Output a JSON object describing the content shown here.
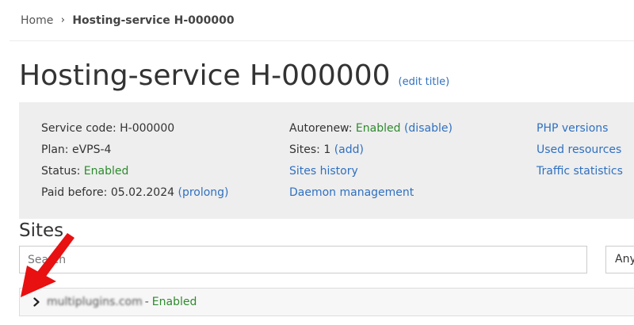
{
  "breadcrumb": {
    "home": "Home",
    "separator": "›",
    "current": "Hosting-service H-000000"
  },
  "page": {
    "title": "Hosting-service H-000000",
    "edit_title": "(edit title)"
  },
  "info": {
    "col1": {
      "service_code_label": "Service code:",
      "service_code_value": "H-000000",
      "plan_label": "Plan:",
      "plan_value": "eVPS-4",
      "status_label": "Status:",
      "status_value": "Enabled",
      "paid_before_label": "Paid before:",
      "paid_before_value": "05.02.2024",
      "prolong": "(prolong)"
    },
    "col2": {
      "autorenew_label": "Autorenew:",
      "autorenew_value": "Enabled",
      "autorenew_action": "(disable)",
      "sites_label": "Sites:",
      "sites_value": "1",
      "sites_add": "(add)",
      "sites_history": "Sites history",
      "daemon_management": "Daemon management"
    },
    "col3": {
      "php_versions": "PHP versions",
      "used_resources": "Used resources",
      "traffic_statistics": "Traffic statistics"
    }
  },
  "sites": {
    "heading": "Sites",
    "search_placeholder": "Search",
    "filter_selected": "Any",
    "rows": [
      {
        "domain": "multiplugins.com",
        "separator": "-",
        "status": "Enabled"
      }
    ]
  },
  "colors": {
    "link": "#3070c0",
    "enabled": "#2e8a2e",
    "panel_bg": "#eeeeee",
    "annotation_arrow": "#e81010"
  },
  "icons": {
    "breadcrumb_separator": "chevron-right-icon",
    "row_expand": "chevron-right-icon",
    "annotation": "red-arrow-icon"
  }
}
